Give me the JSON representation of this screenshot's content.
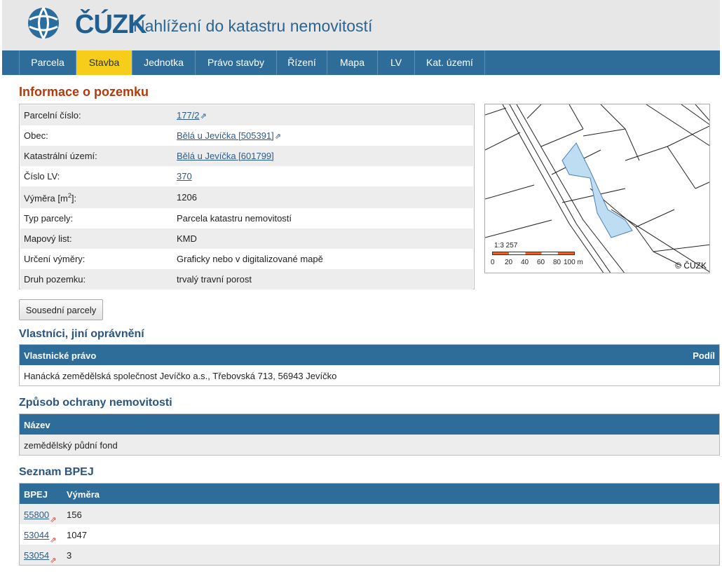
{
  "header": {
    "logo_text": "ČÚZK",
    "app_title": "Nahlížení do katastru nemovitostí",
    "brand_color": "#1f5e8f"
  },
  "nav": {
    "items": [
      "Parcela",
      "Stavba",
      "Jednotka",
      "Právo stavby",
      "Řízení",
      "Mapa",
      "LV",
      "Kat. území"
    ],
    "active": "Stavba"
  },
  "info": {
    "title": "Informace o pozemku",
    "rows": [
      {
        "label": "Parcelní číslo:",
        "value": "177/2"
      },
      {
        "label": "Obec:",
        "value": "Bělá u Jevíčka [505391]"
      },
      {
        "label": "Katastrální území:",
        "value": "Bělá u Jevíčka [601799]"
      },
      {
        "label": "Číslo LV:",
        "value": "370"
      },
      {
        "label": "Výměra [m",
        "label_sup": "2",
        "label_end": "]:",
        "value": "1206"
      },
      {
        "label": "Typ parcely:",
        "value": "Parcela katastru nemovitostí"
      },
      {
        "label": "Mapový list:",
        "value": "KMD"
      },
      {
        "label": "Určení výměry:",
        "value": "Graficky nebo v digitalizované mapě"
      },
      {
        "label": "Druh pozemku:",
        "value": "trvalý travní porost"
      }
    ]
  },
  "map": {
    "scale": "1:3 257",
    "ticks": [
      "0",
      "20",
      "40",
      "60",
      "80",
      "100 m"
    ],
    "copyright": "© ČÚZK"
  },
  "neighbours_button": "Sousední parcely",
  "owners": {
    "title": "Vlastníci, jiní oprávnění",
    "col1": "Vlastnické právo",
    "col2": "Podíl",
    "rows": [
      "Hanácká zemědělská společnost Jevíčko a.s., Třebovská 713, 56943 Jevíčko"
    ]
  },
  "protection": {
    "title": "Způsob ochrany nemovitosti",
    "col1": "Název",
    "rows": [
      "zemědělský půdní fond"
    ]
  },
  "bpej": {
    "title": "Seznam BPEJ",
    "col1": "BPEJ",
    "col2": "Výměra",
    "rows": [
      {
        "code": "55800",
        "area": "156"
      },
      {
        "code": "53044",
        "area": "1047"
      },
      {
        "code": "53054",
        "area": "3"
      }
    ]
  }
}
